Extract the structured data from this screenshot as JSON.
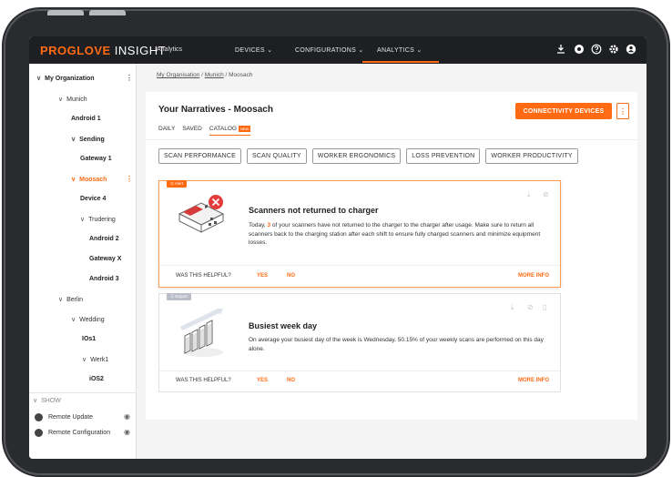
{
  "brand": {
    "name": "PROGLOVE",
    "suffix": " INSIGHT",
    "app": "Analytics"
  },
  "nav": {
    "devices": "DEVICES",
    "configurations": "CONFIGURATIONS",
    "analytics": "ANALYTICS",
    "chevron": "⌄",
    "icons": [
      "download-icon",
      "notification-icon",
      "help-icon",
      "settings-icon",
      "user-icon"
    ]
  },
  "sidebar": {
    "org": "My Organization",
    "items": [
      {
        "label": "Munich"
      },
      {
        "label": "Android 1"
      },
      {
        "label": "Sending"
      },
      {
        "label": "Gateway 1"
      },
      {
        "label": "Moosach"
      },
      {
        "label": "Device 4"
      },
      {
        "label": "Trudering"
      },
      {
        "label": "Android 2"
      },
      {
        "label": "Gateway X"
      },
      {
        "label": "Android 3"
      },
      {
        "label": "Berlin"
      },
      {
        "label": "Wedding"
      },
      {
        "label": "IOs1"
      },
      {
        "label": "Werk1"
      },
      {
        "label": "iOS2"
      }
    ],
    "show": "SHOW",
    "toggles": [
      "Remote Update",
      "Remote Configuration"
    ]
  },
  "breadcrumb": {
    "a": "My Organisation",
    "b": "Munich",
    "c": "Moosach",
    "sep": " / "
  },
  "main": {
    "title": "Your Narratives - Moosach",
    "tabs": {
      "daily": "DAILY",
      "saved": "SAVED",
      "catalog": "CATALOG",
      "new": "NEW"
    },
    "cta": "CONNECTIVITY DEVICES",
    "chips": [
      "SCAN PERFORMANCE",
      "SCAN QUALITY",
      "WORKER ERGONOMICS",
      "LOSS PREVENTION",
      "WORKER PRODUCTIVITY"
    ]
  },
  "cards": [
    {
      "tag": "Alert",
      "title": "Scanners not returned to charger",
      "text_pre": "Today, ",
      "text_num": "3",
      "text_post": " of your scanners have not returned to the charger to the charger after usage. Make sure to return all scanners back to the charging station after each shift to ensure fully charged scanners and minimize equipment losses.",
      "question": "WAS THIS HELPFUL?",
      "yes": "YES",
      "no": "NO",
      "more": "MORE INFO"
    },
    {
      "tag": "Report",
      "title": "Busiest week day",
      "text": "On average your busiest day of the week is Wednesday. 50.15% of your weekly scans are performed on this day alone.",
      "question": "WAS THIS HELPFUL?",
      "yes": "YES",
      "no": "NO",
      "more": "MORE INFO"
    }
  ],
  "colors": {
    "accent": "#ff6a13",
    "topbar": "#1d1f22",
    "alert_red": "#e63b3b"
  }
}
